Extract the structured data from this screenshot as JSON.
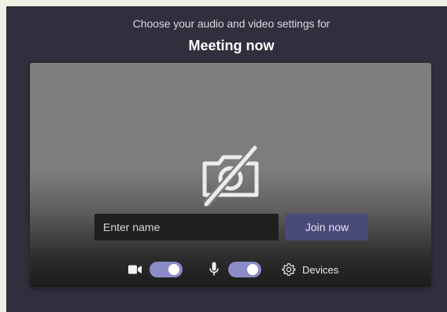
{
  "header": {
    "subtitle": "Choose your audio and video settings for",
    "meeting_title": "Meeting now"
  },
  "preview": {
    "camera_state_icon": "camera-off-icon"
  },
  "join": {
    "name_placeholder": "Enter name",
    "name_value": "",
    "join_label": "Join now"
  },
  "controls": {
    "video": {
      "icon": "video-camera-icon",
      "enabled": true
    },
    "audio": {
      "icon": "microphone-icon",
      "enabled": true
    },
    "devices_label": "Devices",
    "devices_icon": "gear-icon"
  },
  "colors": {
    "background": "#2f2f3d",
    "toggle_on": "#8b8cc7",
    "join_button": "#4a4a78"
  }
}
